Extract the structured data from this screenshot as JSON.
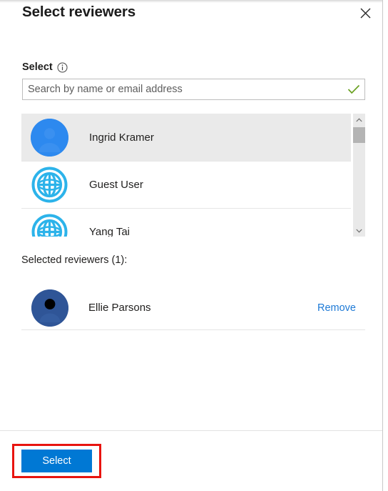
{
  "dialog": {
    "title": "Select reviewers",
    "close_icon": "close-icon"
  },
  "field": {
    "label": "Select",
    "info_icon": "info-icon"
  },
  "search": {
    "value": "",
    "placeholder": "Search by name or email address",
    "valid_icon": "checkmark-icon",
    "valid_color": "#6aa121"
  },
  "results": {
    "items": [
      {
        "name": "Ingrid Kramer",
        "avatar_type": "person",
        "avatar_color": "#2d89ef",
        "selected": true
      },
      {
        "name": "Guest User",
        "avatar_type": "globe",
        "avatar_color": "#2cb3ea",
        "selected": false
      },
      {
        "name": "Yang Tai",
        "avatar_type": "globe",
        "avatar_color": "#2cb3ea",
        "selected": false
      }
    ],
    "scrollbar": {
      "up_icon": "chevron-up-icon",
      "down_icon": "chevron-down-icon"
    }
  },
  "selected": {
    "heading": "Selected reviewers (1):",
    "items": [
      {
        "name": "Ellie Parsons",
        "avatar_type": "person",
        "avatar_color": "#2f5597",
        "remove_label": "Remove"
      }
    ]
  },
  "footer": {
    "select_label": "Select",
    "select_color": "#0078d4",
    "annotation_color": "#e8140f"
  }
}
